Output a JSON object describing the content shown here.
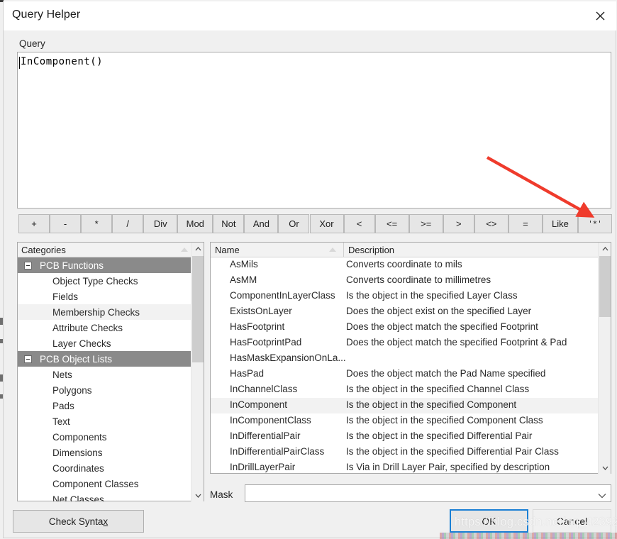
{
  "window": {
    "title": "Query Helper",
    "close_icon": "close-icon"
  },
  "query": {
    "label": "Query",
    "value": "InComponent()",
    "placeholder": ""
  },
  "operators": [
    {
      "label": "+",
      "name": "op-plus"
    },
    {
      "label": "-",
      "name": "op-minus"
    },
    {
      "label": "*",
      "name": "op-multiply"
    },
    {
      "label": "/",
      "name": "op-divide"
    },
    {
      "label": "Div",
      "name": "op-div"
    },
    {
      "label": "Mod",
      "name": "op-mod"
    },
    {
      "label": "Not",
      "name": "op-not"
    },
    {
      "label": "And",
      "name": "op-and"
    },
    {
      "label": "Or",
      "name": "op-or"
    },
    {
      "label": "Xor",
      "name": "op-xor"
    },
    {
      "label": "<",
      "name": "op-less-than"
    },
    {
      "label": "<=",
      "name": "op-less-equal"
    },
    {
      "label": ">=",
      "name": "op-greater-equal"
    },
    {
      "label": ">",
      "name": "op-greater-than"
    },
    {
      "label": "<>",
      "name": "op-not-equal"
    },
    {
      "label": "=",
      "name": "op-equal"
    },
    {
      "label": "Like",
      "name": "op-like"
    },
    {
      "label": "'*'",
      "name": "op-wildcard"
    }
  ],
  "categories": {
    "header": "Categories",
    "sort_indicator": "ascending",
    "items": [
      {
        "label": "PCB Functions",
        "type": "group",
        "expanded": true,
        "selected": true
      },
      {
        "label": "Object Type Checks",
        "type": "child",
        "selected": false
      },
      {
        "label": "Fields",
        "type": "child",
        "selected": false
      },
      {
        "label": "Membership Checks",
        "type": "child",
        "selected": true
      },
      {
        "label": "Attribute Checks",
        "type": "child",
        "selected": false
      },
      {
        "label": "Layer Checks",
        "type": "child",
        "selected": false
      },
      {
        "label": "PCB Object Lists",
        "type": "group",
        "expanded": true,
        "selected": true
      },
      {
        "label": "Nets",
        "type": "child",
        "selected": false
      },
      {
        "label": "Polygons",
        "type": "child",
        "selected": false
      },
      {
        "label": "Pads",
        "type": "child",
        "selected": false
      },
      {
        "label": "Text",
        "type": "child",
        "selected": false
      },
      {
        "label": "Components",
        "type": "child",
        "selected": false
      },
      {
        "label": "Dimensions",
        "type": "child",
        "selected": false
      },
      {
        "label": "Coordinates",
        "type": "child",
        "selected": false
      },
      {
        "label": "Component Classes",
        "type": "child",
        "selected": false
      },
      {
        "label": "Net Classes",
        "type": "child",
        "selected": false
      }
    ]
  },
  "functions": {
    "columns": {
      "name": "Name",
      "description": "Description"
    },
    "sort_indicator": "ascending",
    "rows": [
      {
        "name": "AsMils",
        "description": "Converts coordinate to mils",
        "selected": false
      },
      {
        "name": "AsMM",
        "description": "Converts coordinate to millimetres",
        "selected": false
      },
      {
        "name": "ComponentInLayerClass",
        "description": "Is the object in the specified Layer Class",
        "selected": false
      },
      {
        "name": "ExistsOnLayer",
        "description": "Does the object exist on the specified Layer",
        "selected": false
      },
      {
        "name": "HasFootprint",
        "description": "Does the object match the specified Footprint",
        "selected": false
      },
      {
        "name": "HasFootprintPad",
        "description": "Does the object match the specified Footprint & Pad",
        "selected": false
      },
      {
        "name": "HasMaskExpansionOnLa...",
        "description": "",
        "selected": false
      },
      {
        "name": "HasPad",
        "description": "Does the object match the Pad Name specified",
        "selected": false
      },
      {
        "name": "InChannelClass",
        "description": "Is the object in the specified Channel Class",
        "selected": false
      },
      {
        "name": "InComponent",
        "description": "Is the object in the specified Component",
        "selected": true
      },
      {
        "name": "InComponentClass",
        "description": "Is the object in the specified Component Class",
        "selected": false
      },
      {
        "name": "InDifferentialPair",
        "description": "Is the object in the specified Differential Pair",
        "selected": false
      },
      {
        "name": "InDifferentialPairClass",
        "description": "Is the object in the specified Differential Pair Class",
        "selected": false
      },
      {
        "name": "InDrillLayerPair",
        "description": "Is Via in Drill Layer Pair, specified by description",
        "selected": false
      }
    ]
  },
  "mask": {
    "label": "Mask",
    "value": "",
    "placeholder": ""
  },
  "buttons": {
    "check_syntax": "Check Synta",
    "check_syntax_mnemonic": "x",
    "ok": "OK",
    "cancel": "Cancel"
  },
  "annotation": {
    "arrow_color": "#ef3b2c",
    "points_to": "op-wildcard"
  },
  "watermark": "https://blog.csdn.net/qq_42392872"
}
